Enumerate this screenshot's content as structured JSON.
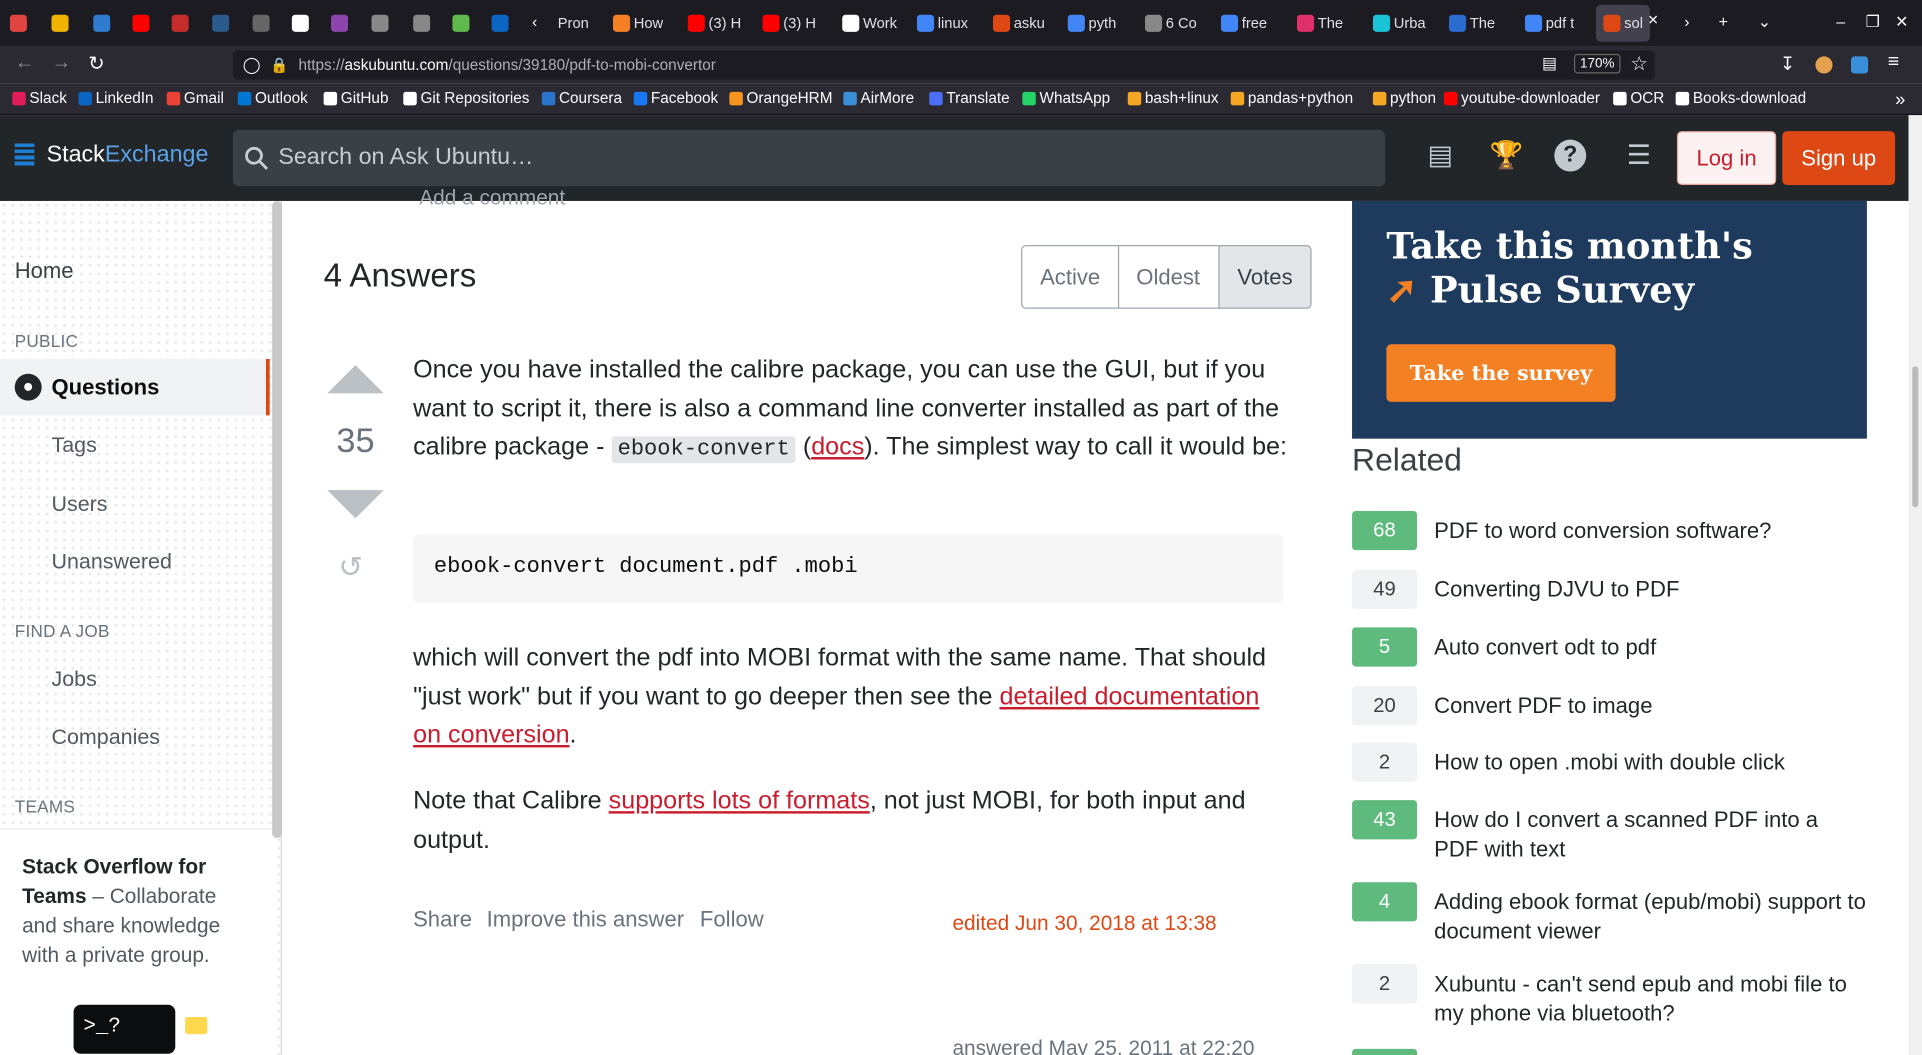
{
  "browser": {
    "tabs": [
      {
        "label": "",
        "color": "#e0443e"
      },
      {
        "label": "",
        "color": "#f0b400"
      },
      {
        "label": "",
        "color": "#2e7bcf"
      },
      {
        "label": "",
        "color": "#ff0000"
      },
      {
        "label": "",
        "color": "#c72c2c"
      },
      {
        "label": "",
        "color": "#2a5b8a"
      },
      {
        "label": "",
        "color": "#666"
      },
      {
        "label": "",
        "color": "#ffffff"
      },
      {
        "label": "",
        "color": "#8e44ad"
      },
      {
        "label": "",
        "color": "#888"
      },
      {
        "label": "",
        "color": "#888"
      },
      {
        "label": "",
        "color": "#5eba4d"
      },
      {
        "label": "",
        "color": "#0a66c2"
      },
      {
        "label": "Pron",
        "color": ""
      },
      {
        "label": "How",
        "color": "#f48024"
      },
      {
        "label": "(3) H",
        "color": "#ff0000"
      },
      {
        "label": "(3) H",
        "color": "#ff0000"
      },
      {
        "label": "Work",
        "color": "#ffffff"
      },
      {
        "label": "linux",
        "color": "#4285f4"
      },
      {
        "label": "asku",
        "color": "#dd4814"
      },
      {
        "label": "pyth",
        "color": "#4285f4"
      },
      {
        "label": "6 Co",
        "color": "#888"
      },
      {
        "label": "free",
        "color": "#4285f4"
      },
      {
        "label": "The",
        "color": "#e0306a"
      },
      {
        "label": "Urba",
        "color": "#1ac3d6"
      },
      {
        "label": "The",
        "color": "#2a6bd0"
      },
      {
        "label": "pdf t",
        "color": "#4285f4"
      },
      {
        "label": "sol",
        "color": "#dd4814"
      }
    ],
    "url": "https://askubuntu.com/questions/39180/pdf-to-mobi-convertor",
    "url_host": "askubuntu.com",
    "url_pre": "https://",
    "url_path": "/questions/39180/pdf-to-mobi-convertor",
    "zoom": "170%",
    "bookmarks": [
      "Slack",
      "LinkedIn",
      "Gmail",
      "Outlook",
      "GitHub",
      "Git Repositories",
      "Coursera",
      "Facebook",
      "OrangeHRM",
      "AirMore",
      "Translate",
      "WhatsApp",
      "bash+linux",
      "pandas+python",
      "python",
      "youtube-downloader",
      "OCR",
      "Books-download"
    ],
    "bookmark_colors": [
      "#e01e5a",
      "#0a66c2",
      "#ea4335",
      "#0078d4",
      "#ffffff",
      "#ffffff",
      "#2a73cc",
      "#1877f2",
      "#f7941d",
      "#3a8fd8",
      "#4a6ef5",
      "#25d366",
      "#f5a623",
      "#f5a623",
      "#f5a623",
      "#ff0000",
      "#ffffff",
      "#ffffff"
    ]
  },
  "header": {
    "logo_a": "Stack",
    "logo_b": "Exchange",
    "search_placeholder": "Search on Ask Ubuntu…",
    "login": "Log in",
    "signup": "Sign up",
    "icons": [
      "inbox-icon",
      "trophy-icon",
      "help-icon",
      "site-switcher-icon"
    ]
  },
  "leftnav": {
    "home": "Home",
    "public": "PUBLIC",
    "questions": "Questions",
    "tags": "Tags",
    "users": "Users",
    "unanswered": "Unanswered",
    "find_job": "FIND A JOB",
    "jobs": "Jobs",
    "companies": "Companies",
    "teams": "TEAMS",
    "teams_title": "Stack Overflow for Teams",
    "teams_desc": " – Collaborate and share knowledge with a private group.",
    "prompt": ">_?"
  },
  "main": {
    "add_comment": "Add a comment",
    "answers_count": "4 Answers",
    "sort": [
      "Active",
      "Oldest",
      "Votes"
    ],
    "votes": "35",
    "p1_a": "Once you have installed the calibre package, you can use the GUI, but if you want to script it, there is also a command line converter installed as part of the calibre package - ",
    "p1_code": "ebook-convert",
    "p1_b": " (",
    "p1_link": "docs",
    "p1_c": "). The simplest way to call it would be:",
    "pre": "ebook-convert document.pdf .mobi",
    "p2_a": "which will convert the pdf into MOBI format with the same name. That should \"just work\" but if you want to go deeper then see the ",
    "p2_link": "detailed documentation on conversion",
    "p2_b": ".",
    "p3_a": "Note that Calibre ",
    "p3_link": "supports lots of formats",
    "p3_b": ", not just MOBI, for both input and output.",
    "share": "Share",
    "improve": "Improve this answer",
    "follow": "Follow",
    "edited": "edited Jun 30, 2018 at 13:38",
    "answered": "answered May 25, 2011 at 22:20"
  },
  "sidebar": {
    "ad_line1": "Take this month's",
    "ad_line2": "Pulse Survey",
    "ad_button": "Take the survey",
    "related_title": "Related",
    "related": [
      {
        "score": "68",
        "answered": true,
        "title": "PDF to word conversion software?"
      },
      {
        "score": "49",
        "answered": false,
        "title": "Converting DJVU to PDF"
      },
      {
        "score": "5",
        "answered": true,
        "title": "Auto convert odt to pdf"
      },
      {
        "score": "20",
        "answered": false,
        "title": "Convert PDF to image"
      },
      {
        "score": "2",
        "answered": false,
        "title": "How to open .mobi with double click"
      },
      {
        "score": "43",
        "answered": true,
        "title": "How do I convert a scanned PDF into a PDF with text"
      },
      {
        "score": "4",
        "answered": true,
        "title": "Adding ebook format (epub/mobi) support to document viewer"
      },
      {
        "score": "2",
        "answered": false,
        "title": "Xubuntu - can't send epub and mobi file to my phone via bluetooth?"
      }
    ]
  }
}
